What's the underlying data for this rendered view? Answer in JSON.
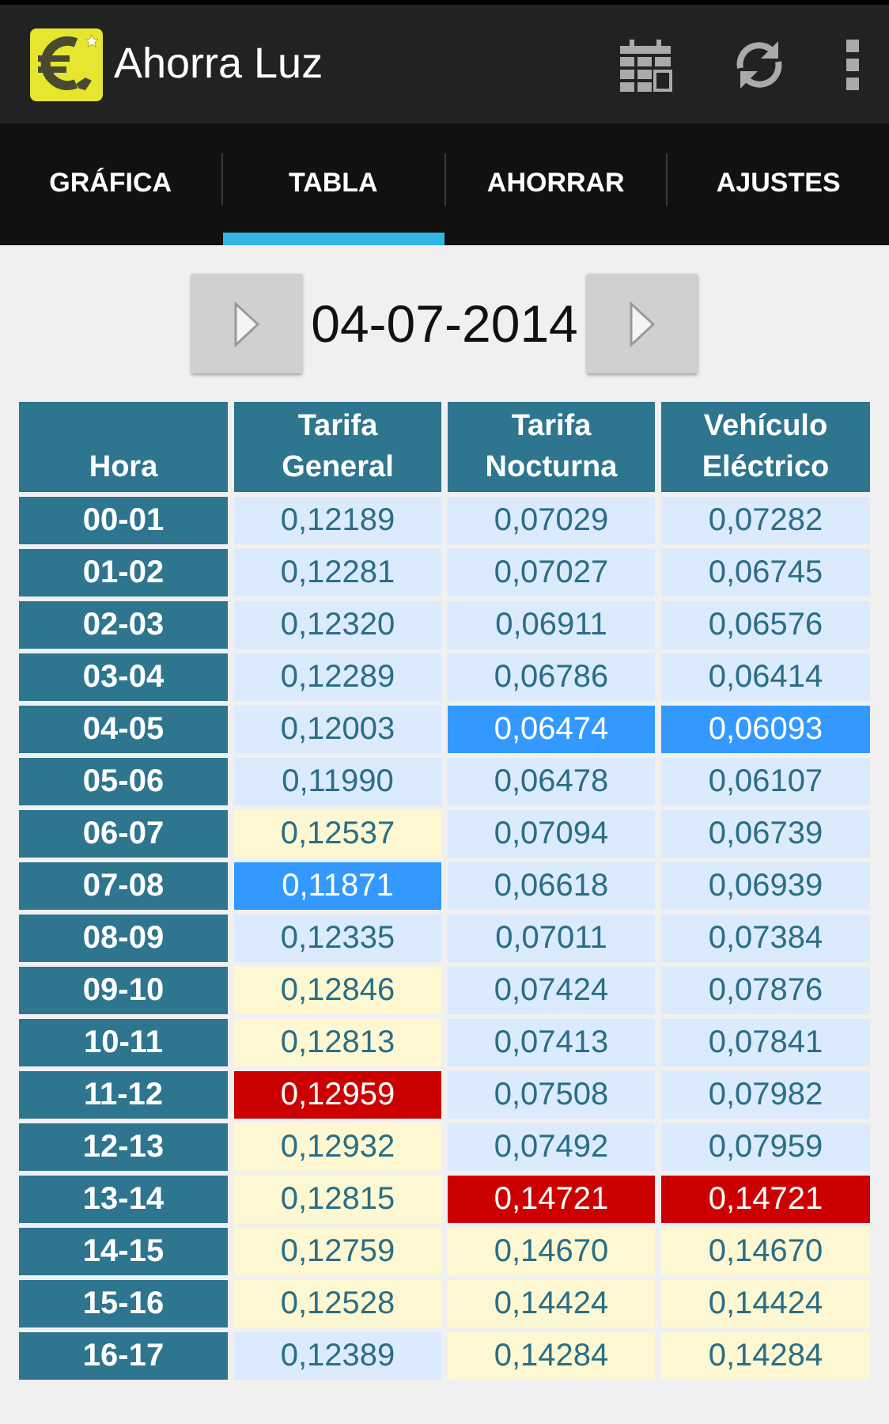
{
  "app_bar": {
    "title": "Ahorra Luz"
  },
  "tabs": [
    {
      "label": "GRÁFICA",
      "selected": false
    },
    {
      "label": "TABLA",
      "selected": true
    },
    {
      "label": "AHORRAR",
      "selected": false
    },
    {
      "label": "AJUSTES",
      "selected": false
    }
  ],
  "date": "04-07-2014",
  "table": {
    "columns": [
      "Hora",
      "Tarifa General",
      "Tarifa Nocturna",
      "Vehículo Eléctrico"
    ],
    "rows": [
      {
        "cells": [
          {
            "value": "00-01",
            "kind": "hour"
          },
          {
            "value": "0,12189",
            "kind": "low"
          },
          {
            "value": "0,07029",
            "kind": "low"
          },
          {
            "value": "0,07282",
            "kind": "low"
          }
        ]
      },
      {
        "cells": [
          {
            "value": "01-02",
            "kind": "hour"
          },
          {
            "value": "0,12281",
            "kind": "low"
          },
          {
            "value": "0,07027",
            "kind": "low"
          },
          {
            "value": "0,06745",
            "kind": "low"
          }
        ]
      },
      {
        "cells": [
          {
            "value": "02-03",
            "kind": "hour"
          },
          {
            "value": "0,12320",
            "kind": "low"
          },
          {
            "value": "0,06911",
            "kind": "low"
          },
          {
            "value": "0,06576",
            "kind": "low"
          }
        ]
      },
      {
        "cells": [
          {
            "value": "03-04",
            "kind": "hour"
          },
          {
            "value": "0,12289",
            "kind": "low"
          },
          {
            "value": "0,06786",
            "kind": "low"
          },
          {
            "value": "0,06414",
            "kind": "low"
          }
        ]
      },
      {
        "cells": [
          {
            "value": "04-05",
            "kind": "hour"
          },
          {
            "value": "0,12003",
            "kind": "low"
          },
          {
            "value": "0,06474",
            "kind": "min"
          },
          {
            "value": "0,06093",
            "kind": "min"
          }
        ]
      },
      {
        "cells": [
          {
            "value": "05-06",
            "kind": "hour"
          },
          {
            "value": "0,11990",
            "kind": "low"
          },
          {
            "value": "0,06478",
            "kind": "low"
          },
          {
            "value": "0,06107",
            "kind": "low"
          }
        ]
      },
      {
        "cells": [
          {
            "value": "06-07",
            "kind": "hour"
          },
          {
            "value": "0,12537",
            "kind": "high"
          },
          {
            "value": "0,07094",
            "kind": "low"
          },
          {
            "value": "0,06739",
            "kind": "low"
          }
        ]
      },
      {
        "cells": [
          {
            "value": "07-08",
            "kind": "hour"
          },
          {
            "value": "0,11871",
            "kind": "min"
          },
          {
            "value": "0,06618",
            "kind": "low"
          },
          {
            "value": "0,06939",
            "kind": "low"
          }
        ]
      },
      {
        "cells": [
          {
            "value": "08-09",
            "kind": "hour"
          },
          {
            "value": "0,12335",
            "kind": "low"
          },
          {
            "value": "0,07011",
            "kind": "low"
          },
          {
            "value": "0,07384",
            "kind": "low"
          }
        ]
      },
      {
        "cells": [
          {
            "value": "09-10",
            "kind": "hour"
          },
          {
            "value": "0,12846",
            "kind": "high"
          },
          {
            "value": "0,07424",
            "kind": "low"
          },
          {
            "value": "0,07876",
            "kind": "low"
          }
        ]
      },
      {
        "cells": [
          {
            "value": "10-11",
            "kind": "hour"
          },
          {
            "value": "0,12813",
            "kind": "high"
          },
          {
            "value": "0,07413",
            "kind": "low"
          },
          {
            "value": "0,07841",
            "kind": "low"
          }
        ]
      },
      {
        "cells": [
          {
            "value": "11-12",
            "kind": "hour"
          },
          {
            "value": "0,12959",
            "kind": "max"
          },
          {
            "value": "0,07508",
            "kind": "low"
          },
          {
            "value": "0,07982",
            "kind": "low"
          }
        ]
      },
      {
        "cells": [
          {
            "value": "12-13",
            "kind": "hour"
          },
          {
            "value": "0,12932",
            "kind": "high"
          },
          {
            "value": "0,07492",
            "kind": "low"
          },
          {
            "value": "0,07959",
            "kind": "low"
          }
        ]
      },
      {
        "cells": [
          {
            "value": "13-14",
            "kind": "hour"
          },
          {
            "value": "0,12815",
            "kind": "high"
          },
          {
            "value": "0,14721",
            "kind": "max"
          },
          {
            "value": "0,14721",
            "kind": "max"
          }
        ]
      },
      {
        "cells": [
          {
            "value": "14-15",
            "kind": "hour"
          },
          {
            "value": "0,12759",
            "kind": "high"
          },
          {
            "value": "0,14670",
            "kind": "high"
          },
          {
            "value": "0,14670",
            "kind": "high"
          }
        ]
      },
      {
        "cells": [
          {
            "value": "15-16",
            "kind": "hour"
          },
          {
            "value": "0,12528",
            "kind": "high"
          },
          {
            "value": "0,14424",
            "kind": "high"
          },
          {
            "value": "0,14424",
            "kind": "high"
          }
        ]
      },
      {
        "cells": [
          {
            "value": "16-17",
            "kind": "hour"
          },
          {
            "value": "0,12389",
            "kind": "low"
          },
          {
            "value": "0,14284",
            "kind": "high"
          },
          {
            "value": "0,14284",
            "kind": "high"
          }
        ]
      }
    ]
  }
}
